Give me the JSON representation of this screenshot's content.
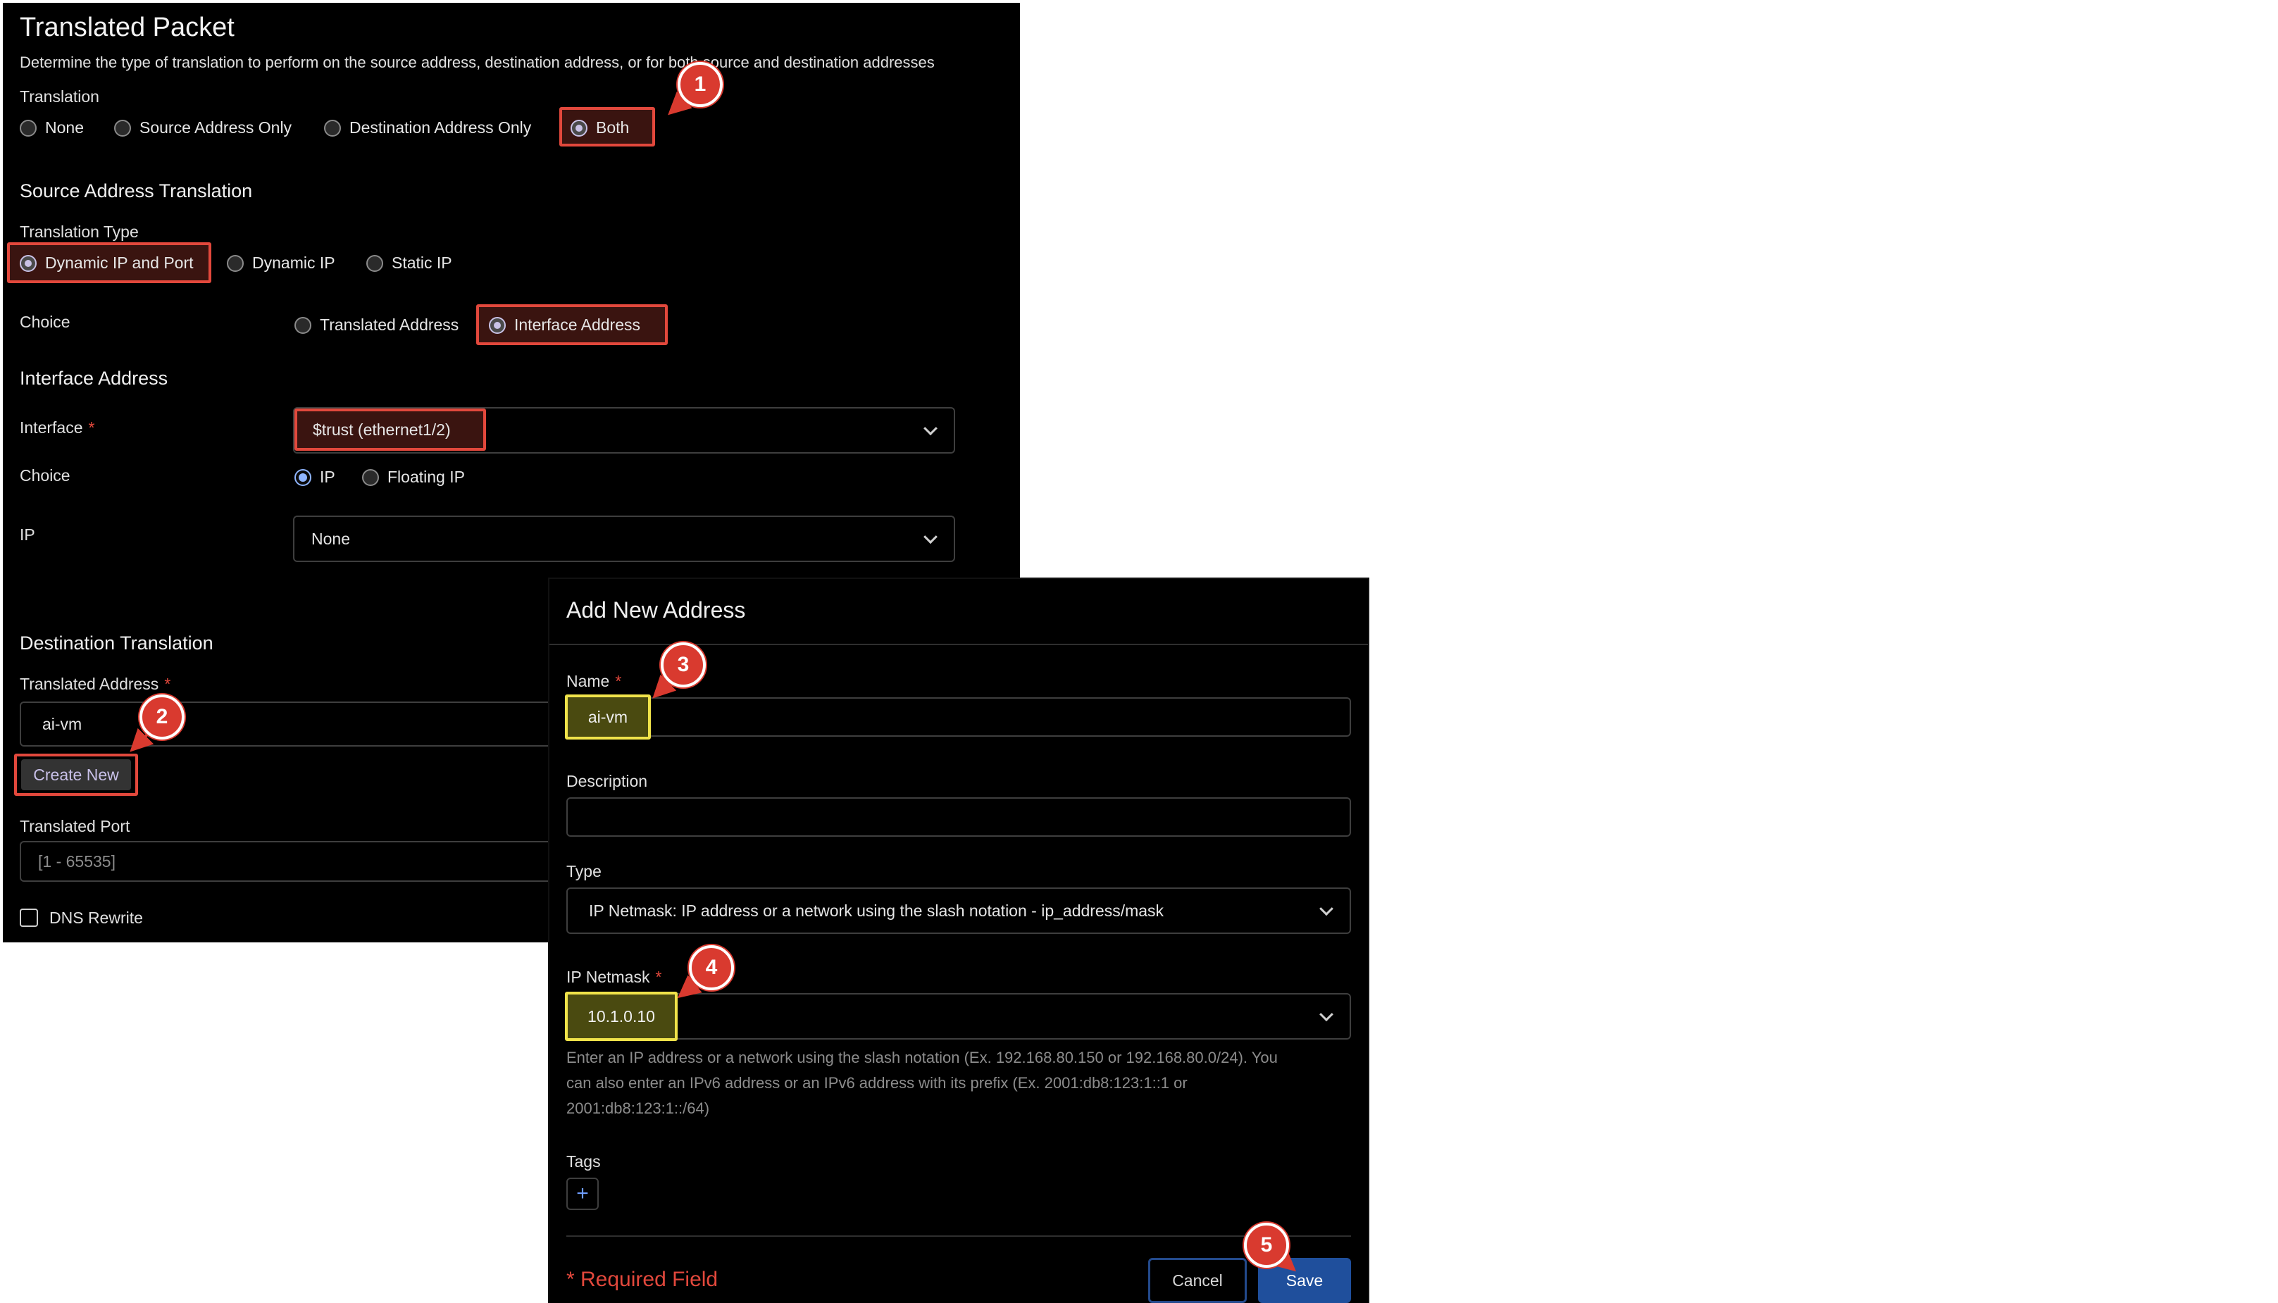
{
  "translated_packet": {
    "title": "Translated Packet",
    "description": "Determine the type of translation to perform on the source address, destination address, or for both source and destination addresses",
    "translation_label": "Translation",
    "translation_options": [
      "None",
      "Source Address Only",
      "Destination Address Only",
      "Both"
    ],
    "translation_selected": "Both"
  },
  "source_translation": {
    "heading": "Source Address Translation",
    "type_label": "Translation Type",
    "type_options": [
      "Dynamic IP and Port",
      "Dynamic IP",
      "Static IP"
    ],
    "type_selected": "Dynamic IP and Port",
    "choice_label": "Choice",
    "choice_options": [
      "Translated Address",
      "Interface Address"
    ],
    "choice_selected": "Interface Address"
  },
  "interface_address": {
    "heading": "Interface Address",
    "interface_label": "Interface",
    "required_mark": "*",
    "interface_value": "$trust (ethernet1/2)",
    "choice_label": "Choice",
    "choice_options": [
      "IP",
      "Floating IP"
    ],
    "choice_selected": "IP",
    "ip_label": "IP",
    "ip_value": "None"
  },
  "destination_translation": {
    "heading": "Destination Translation",
    "address_label": "Translated Address",
    "required_mark": "*",
    "address_value": "ai-vm",
    "create_new_label": "Create New",
    "port_label": "Translated Port",
    "port_placeholder": "[1 - 65535]",
    "dns_rewrite_label": "DNS Rewrite",
    "dns_rewrite_checked": false
  },
  "modal": {
    "title": "Add New Address",
    "name_label": "Name",
    "required_mark": "*",
    "name_value": "ai-vm",
    "description_label": "Description",
    "description_value": "",
    "type_label": "Type",
    "type_value": "IP Netmask: IP address or a network using the slash notation - ip_address/mask",
    "netmask_label": "IP Netmask",
    "netmask_value": "10.1.0.10",
    "hint_line1": "Enter an IP address or a network using the slash notation (Ex. 192.168.80.150 or 192.168.80.0/24). You",
    "hint_line2": "can also enter an IPv6 address or an IPv6 address with its prefix (Ex. 2001:db8:123:1::1 or",
    "hint_line3": "2001:db8:123:1::/64)",
    "tags_label": "Tags",
    "tag_add_symbol": "+",
    "required_field_label": "* Required Field",
    "cancel_label": "Cancel",
    "save_label": "Save"
  },
  "callouts": [
    "1",
    "2",
    "3",
    "4",
    "5"
  ],
  "colors": {
    "panel_bg": "#000000",
    "highlight_red": "#e2483c",
    "highlight_yellow": "#f0e34a",
    "callout_red": "#d93a2f",
    "primary_blue": "#1f4f9c",
    "radio_selected": "#c9c2e6",
    "radio_blue": "#8fb5ff"
  }
}
